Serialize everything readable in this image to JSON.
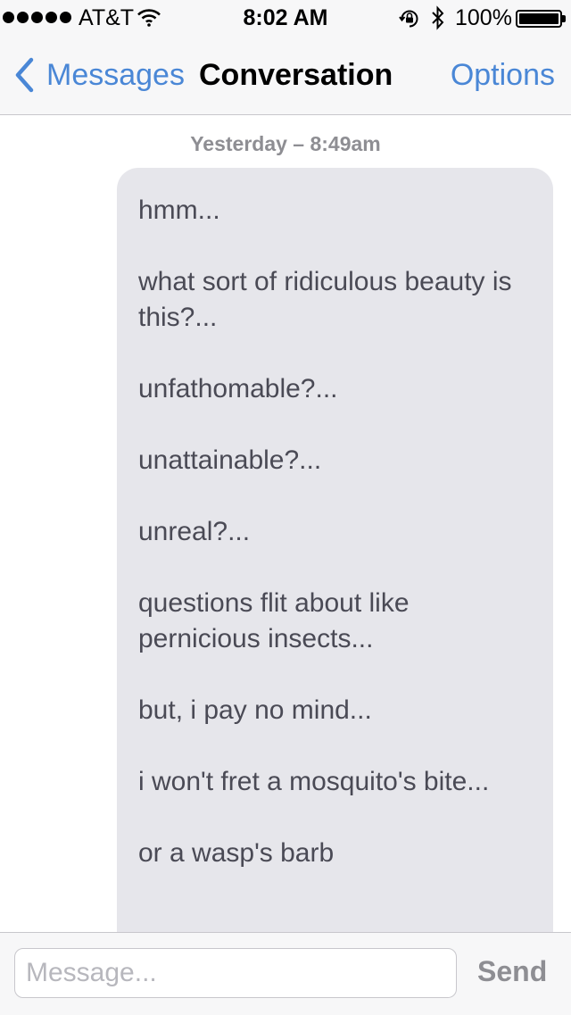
{
  "status_bar": {
    "carrier": "AT&T",
    "time": "8:02 AM",
    "battery_percent": "100%",
    "battery_level": 1.0,
    "signal_bars": 5,
    "icons": [
      "signal-dots-icon",
      "wifi-icon",
      "rotation-lock-icon",
      "bluetooth-icon",
      "battery-icon"
    ]
  },
  "nav": {
    "back_label": "Messages",
    "title": "Conversation",
    "options_label": "Options"
  },
  "conversation": {
    "timestamp": "Yesterday – 8:49am",
    "message_lines": [
      "hmm...",
      "what sort of ridiculous beauty is this?...",
      "unfathomable?...",
      "unattainable?...",
      "unreal?...",
      "questions flit about like pernicious insects...",
      "but, i pay no mind...",
      "i won't fret a mosquito's bite...",
      "or a wasp's barb"
    ]
  },
  "input_bar": {
    "placeholder": "Message...",
    "value": "",
    "send_label": "Send"
  },
  "colors": {
    "accent": "#4a87d6",
    "bubble": "#e6e6eb",
    "bubble_text": "#4a4a55",
    "secondary_text": "#8e8e93",
    "bar_background": "#f7f7f8"
  }
}
